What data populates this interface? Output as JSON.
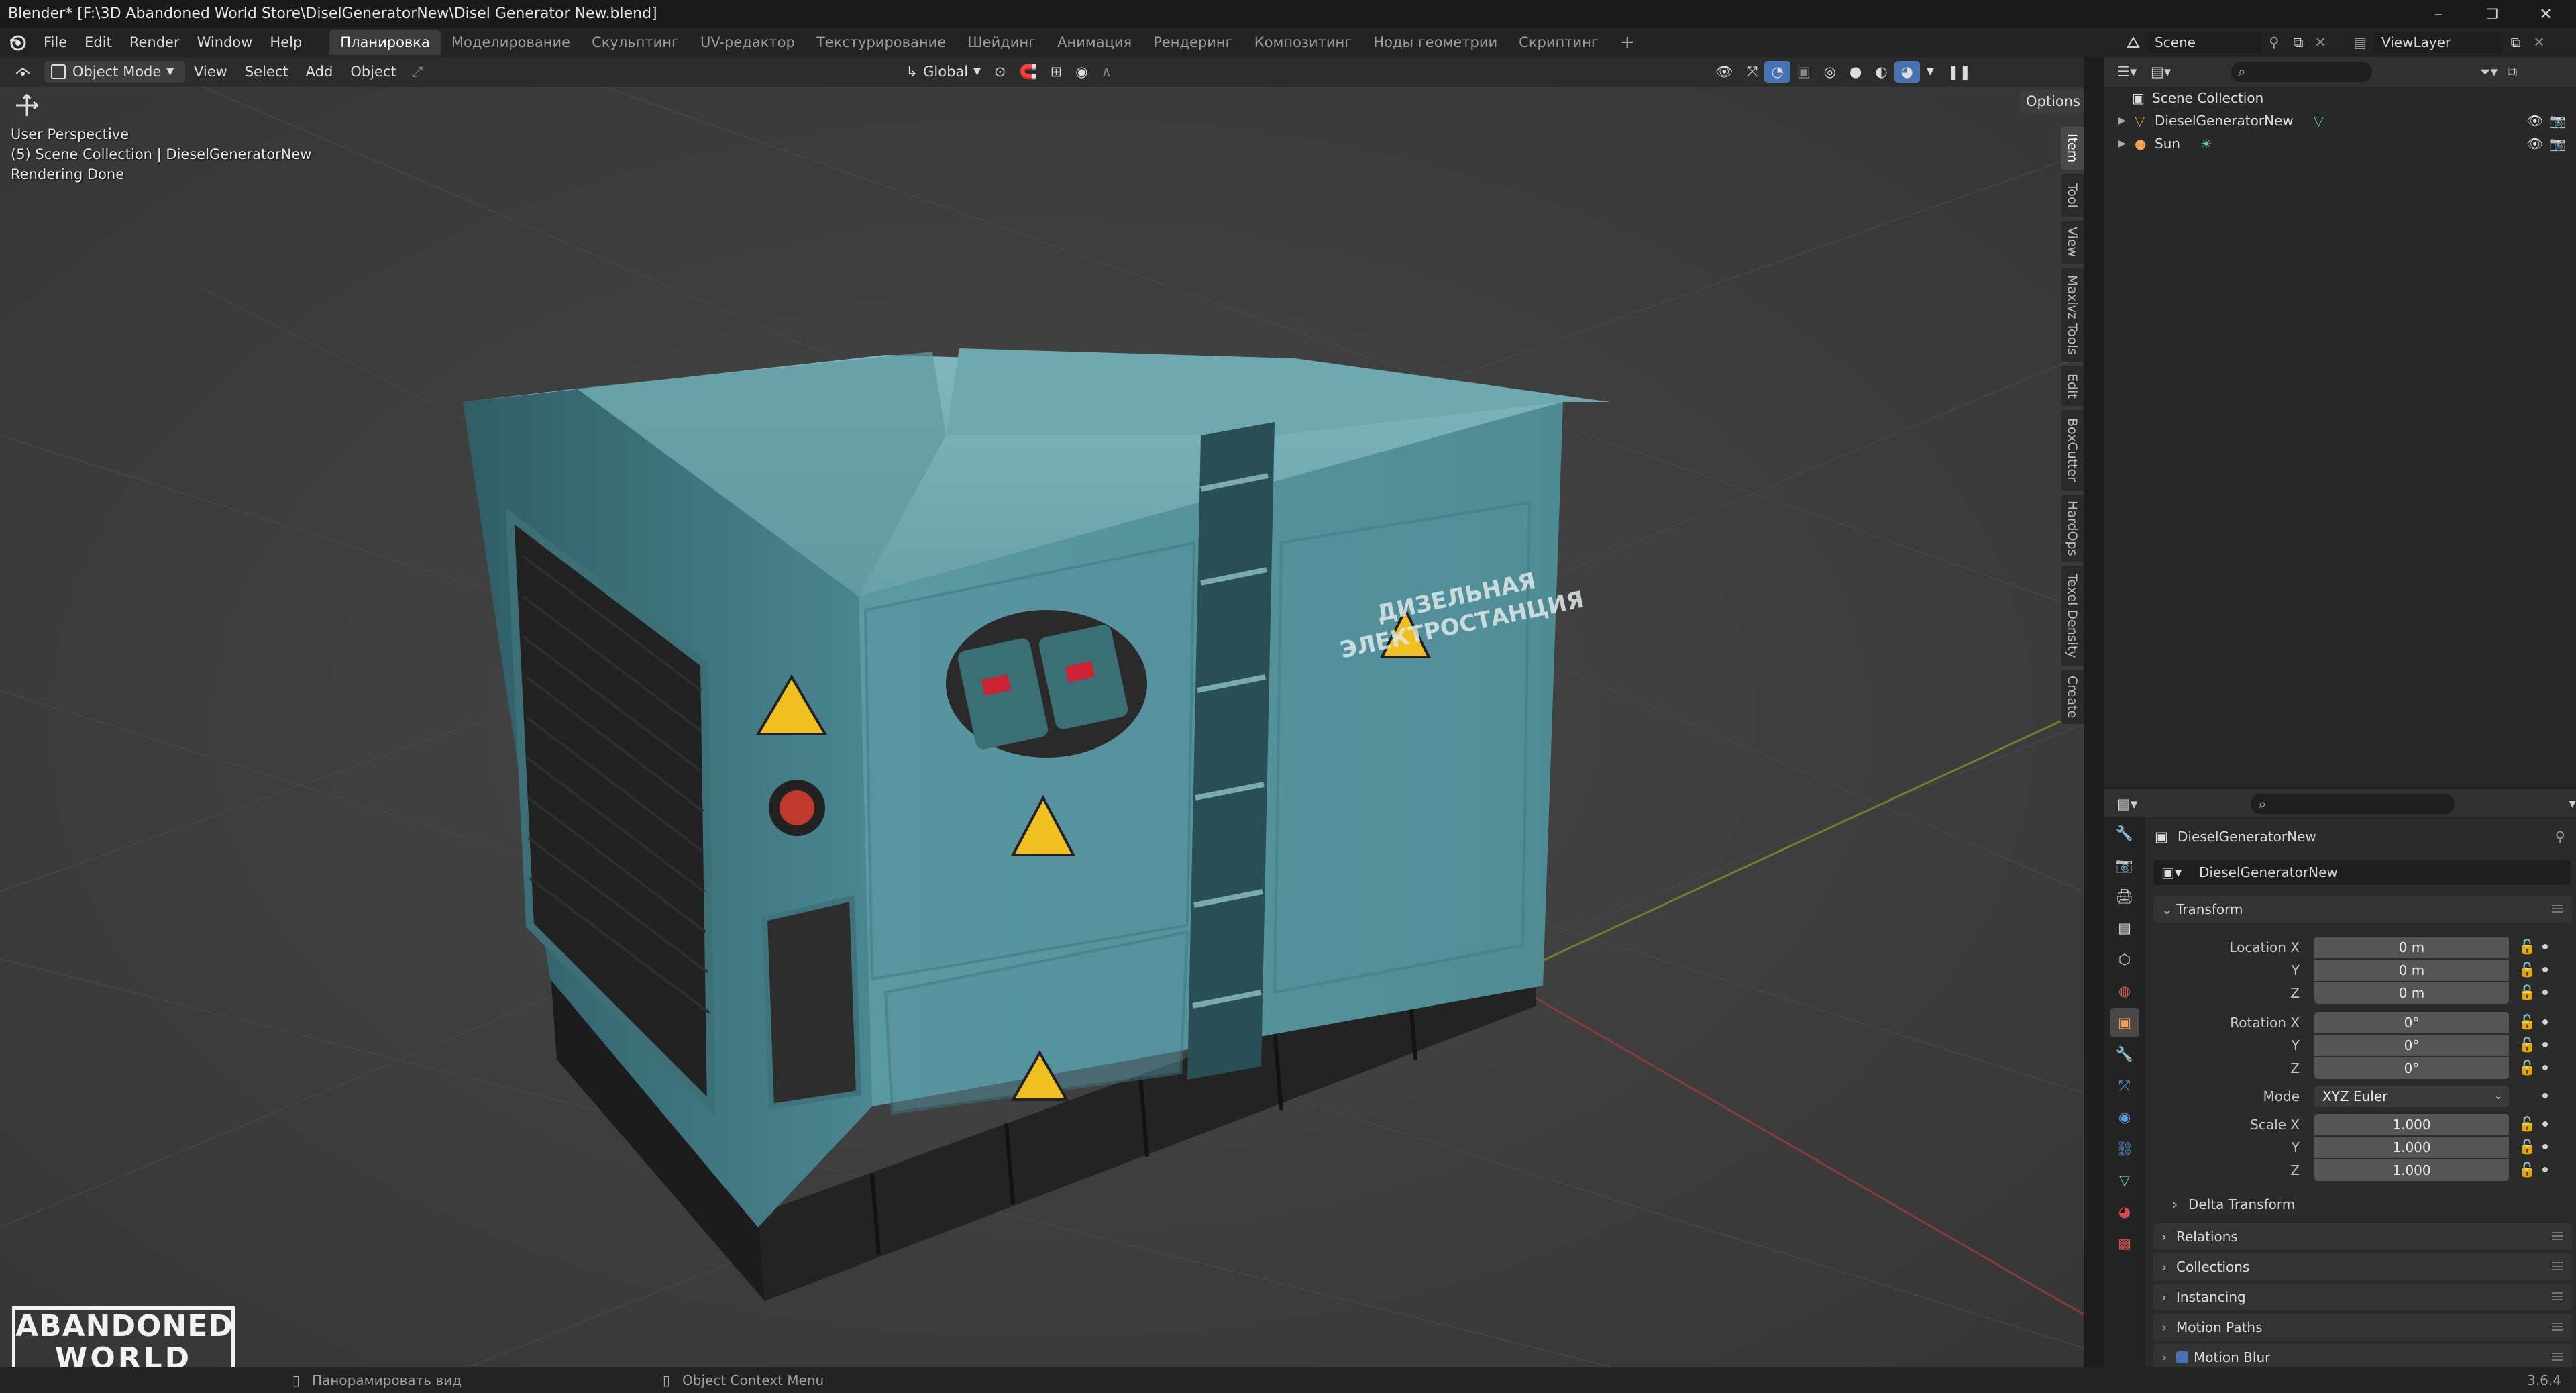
{
  "window": {
    "title": "Blender* [F:\\3D Abandoned World Store\\DiselGeneratorNew\\Disel Generator New.blend]",
    "controls": [
      "–",
      "❐",
      "✕"
    ]
  },
  "menus": [
    "File",
    "Edit",
    "Render",
    "Window",
    "Help"
  ],
  "workspaces": [
    {
      "label": "Планировка",
      "active": true
    },
    {
      "label": "Моделирование"
    },
    {
      "label": "Скульптинг"
    },
    {
      "label": "UV-редактор"
    },
    {
      "label": "Текстурирование"
    },
    {
      "label": "Шейдинг"
    },
    {
      "label": "Анимация"
    },
    {
      "label": "Рендеринг"
    },
    {
      "label": "Композитинг"
    },
    {
      "label": "Ноды геометрии"
    },
    {
      "label": "Скриптинг"
    }
  ],
  "add_workspace": "+",
  "scene": {
    "name": "Scene",
    "view_layer": "ViewLayer"
  },
  "viewport_header": {
    "mode": "Object Mode",
    "menus": [
      "View",
      "Select",
      "Add",
      "Object"
    ],
    "transform_orientation": "Global",
    "options": "Options"
  },
  "viewport_overlay": {
    "line1": "User Perspective",
    "line2": "(5) Scene Collection | DieselGeneratorNew",
    "line3": "Rendering Done"
  },
  "sidebar_tabs": [
    "Item",
    "Tool",
    "View",
    "Maxivz Tools",
    "Edit",
    "BoxCutter",
    "HardOps",
    "Texel Density",
    "Create"
  ],
  "model_labels": {
    "sign_text_line1": "ДИЗЕЛЬНАЯ",
    "sign_text_line2": "ЭЛЕКТРОСТАНЦИЯ"
  },
  "watermark": {
    "line1": "ABANDONED",
    "line2": "WORLD"
  },
  "outliner": {
    "root": "Scene Collection",
    "items": [
      {
        "name": "DieselGeneratorNew"
      },
      {
        "name": "Sun"
      }
    ]
  },
  "properties": {
    "object_name": "DieselGeneratorNew",
    "data_name": "DieselGeneratorNew",
    "transform_title": "Transform",
    "location": {
      "label_x": "Location X",
      "label_y": "Y",
      "label_z": "Z",
      "x": "0 m",
      "y": "0 m",
      "z": "0 m"
    },
    "rotation": {
      "label_x": "Rotation X",
      "label_y": "Y",
      "label_z": "Z",
      "x": "0°",
      "y": "0°",
      "z": "0°"
    },
    "mode": {
      "label": "Mode",
      "value": "XYZ Euler"
    },
    "scale": {
      "label_x": "Scale X",
      "label_y": "Y",
      "label_z": "Z",
      "x": "1.000",
      "y": "1.000",
      "z": "1.000"
    },
    "delta_transform": "Delta Transform",
    "sections": [
      "Relations",
      "Collections",
      "Instancing",
      "Motion Paths",
      "Motion Blur"
    ]
  },
  "status_bar": {
    "pan": "Панорамировать вид",
    "context": "Object Context Menu",
    "version": "3.6.4"
  },
  "colors": {
    "accent": "#4772b3",
    "model_body": "#4f8b93",
    "grid": "#4a4a4a"
  }
}
